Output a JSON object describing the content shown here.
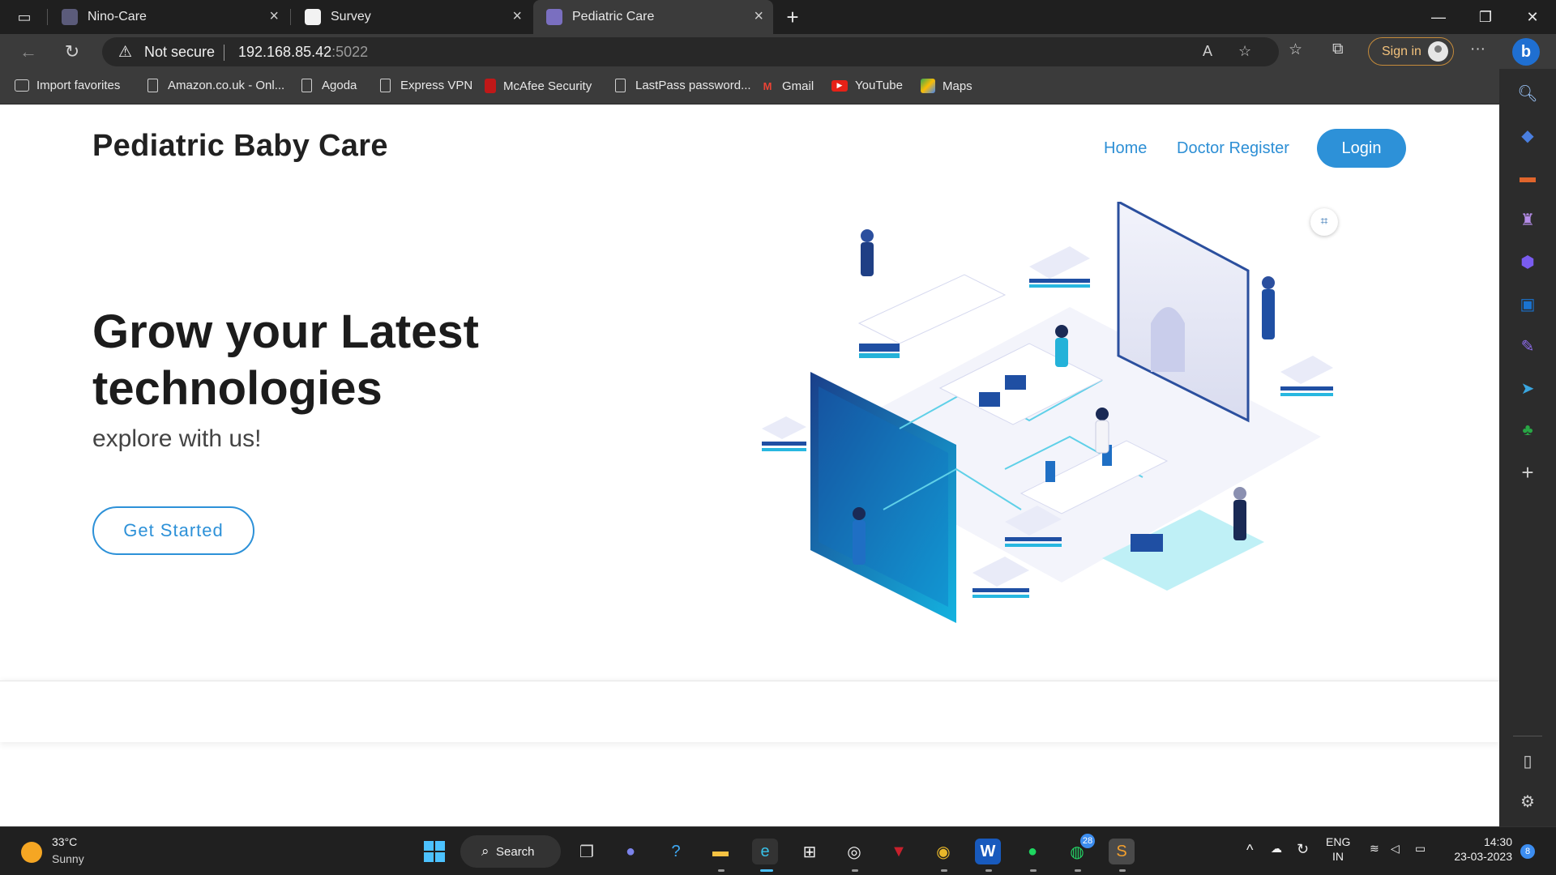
{
  "browser": {
    "tabs": [
      {
        "title": "Nino-Care",
        "active": false
      },
      {
        "title": "Survey",
        "active": false
      },
      {
        "title": "Pediatric Care",
        "active": true
      }
    ],
    "new_tab_label": "+",
    "address": {
      "security_label": "Not secure",
      "host": "192.168.85.42",
      "port": ":5022"
    },
    "sign_in_label": "Sign in",
    "bing_label": "b"
  },
  "favorites": [
    {
      "label": "Import favorites",
      "icon": "import-icon"
    },
    {
      "label": "Amazon.co.uk - Onl...",
      "icon": "page-icon"
    },
    {
      "label": "Agoda",
      "icon": "page-icon"
    },
    {
      "label": "Express VPN",
      "icon": "page-icon"
    },
    {
      "label": "McAfee Security",
      "icon": "mcafee-icon"
    },
    {
      "label": "LastPass password...",
      "icon": "page-icon"
    },
    {
      "label": "Gmail",
      "icon": "gmail-icon"
    },
    {
      "label": "YouTube",
      "icon": "youtube-icon"
    },
    {
      "label": "Maps",
      "icon": "maps-icon"
    }
  ],
  "site": {
    "brand": "Pediatric Baby Care",
    "nav": {
      "home": "Home",
      "doctor_register": "Doctor Register",
      "login": "Login"
    },
    "hero": {
      "title_line1": "Grow your Latest",
      "title_line2": "technologies",
      "subtitle": "explore with us!",
      "cta": "Get Started"
    }
  },
  "taskbar": {
    "weather": {
      "temp": "33°C",
      "desc": "Sunny"
    },
    "search_label": "Search",
    "whatsapp_badge": "28",
    "lang": {
      "line1": "ENG",
      "line2": "IN"
    },
    "clock": {
      "time": "14:30",
      "date": "23-03-2023"
    },
    "notification_badge": "8"
  },
  "colors": {
    "accent": "#2d91d8",
    "chrome_dark": "#1f1f1f",
    "chrome_mid": "#3b3b3b",
    "taskbar": "#202020"
  }
}
